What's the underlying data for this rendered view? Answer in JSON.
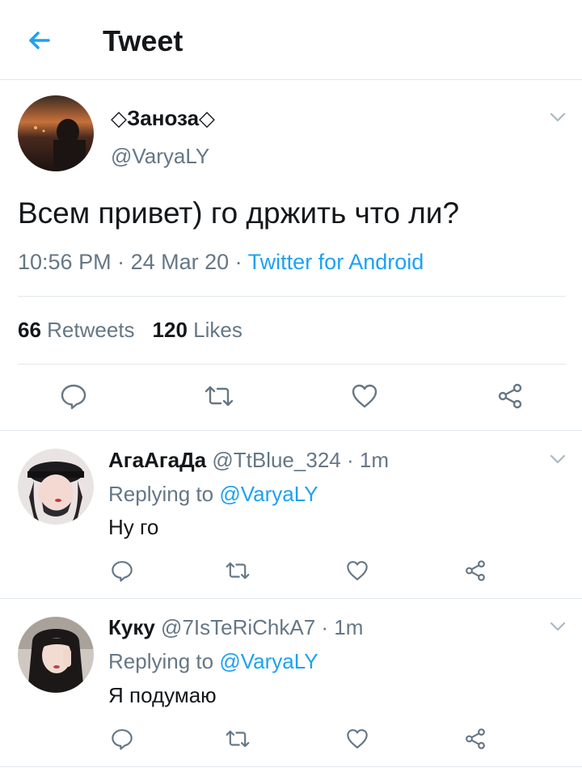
{
  "header": {
    "title": "Tweet"
  },
  "main_tweet": {
    "display_name": "◇Заноза◇",
    "handle": "@VaryaLY",
    "text": "Всем привет) го држить что ли?",
    "time": "10:56 PM",
    "separator": " · ",
    "date": "24 Mar 20",
    "source": "Twitter for Android",
    "retweets_count": "66",
    "retweets_label": "Retweets",
    "likes_count": "120",
    "likes_label": "Likes"
  },
  "replies": [
    {
      "display_name": "АгаАгаДа",
      "handle": "@TtBlue_324",
      "time": "1m",
      "replying_label": "Replying to",
      "replying_to": "@VaryaLY",
      "text": "Ну го"
    },
    {
      "display_name": "Куку",
      "handle": "@7IsTeRiChkA7",
      "time": "1m",
      "replying_label": "Replying to",
      "replying_to": "@VaryaLY",
      "text": "Я подумаю"
    }
  ],
  "icons": {
    "back": "arrow-left-icon",
    "menu": "chevron-down-icon",
    "reply": "reply-bubble-icon",
    "retweet": "retweet-icon",
    "like": "heart-icon",
    "share": "share-icon"
  },
  "colors": {
    "accent": "#1da1f2",
    "secondary_text": "#657786",
    "primary_text": "#14171a",
    "divider": "#e1e8ed"
  }
}
